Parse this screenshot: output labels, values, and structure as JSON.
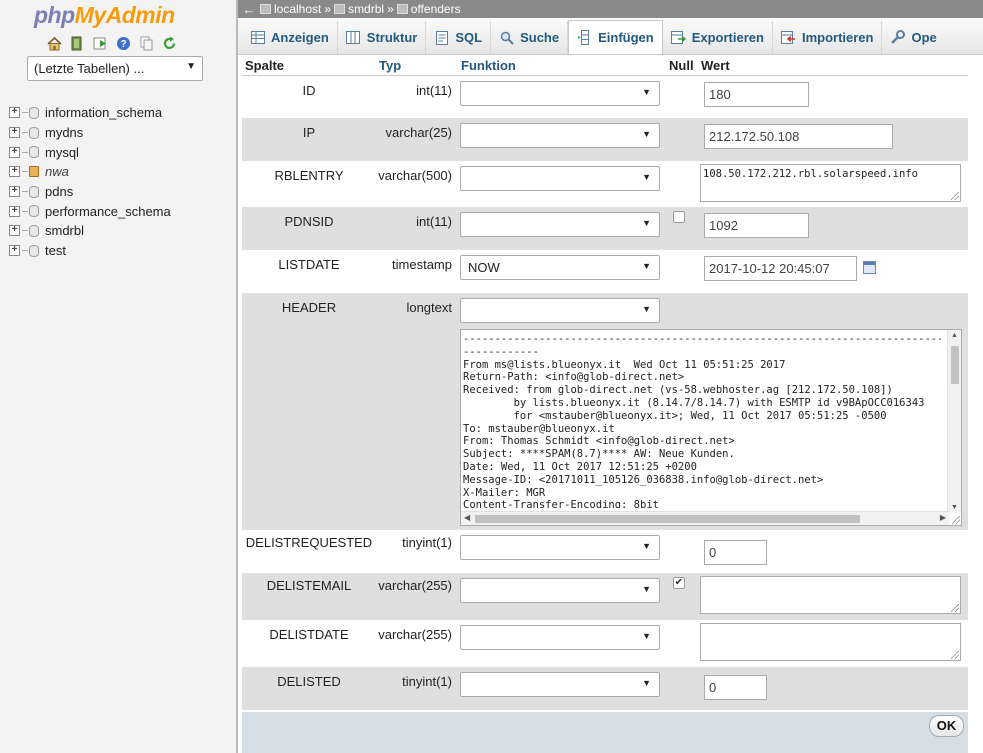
{
  "nav": {
    "logo_php": "php",
    "logo_myadmin": "MyAdmin",
    "icons": [
      "home-icon",
      "logout-icon",
      "query-window-icon",
      "docs-icon",
      "copy-icon",
      "reload-icon"
    ],
    "recent_tables": "(Letzte Tabellen) ...",
    "databases": [
      {
        "name": "information_schema",
        "italic": false
      },
      {
        "name": "mydns",
        "italic": false
      },
      {
        "name": "mysql",
        "italic": false
      },
      {
        "name": "nwa",
        "italic": true
      },
      {
        "name": "pdns",
        "italic": false
      },
      {
        "name": "performance_schema",
        "italic": false
      },
      {
        "name": "smdrbl",
        "italic": false
      },
      {
        "name": "test",
        "italic": false
      }
    ]
  },
  "breadcrumb": {
    "back": "←",
    "server": "localhost",
    "database": "smdrbl",
    "table": "offenders",
    "separator": "»"
  },
  "tabs": [
    {
      "label": "Anzeigen",
      "icon": "browse-icon",
      "active": false
    },
    {
      "label": "Struktur",
      "icon": "structure-icon",
      "active": false
    },
    {
      "label": "SQL",
      "icon": "sql-icon",
      "active": false
    },
    {
      "label": "Suche",
      "icon": "search-icon",
      "active": false
    },
    {
      "label": "Einfügen",
      "icon": "insert-icon",
      "active": true
    },
    {
      "label": "Exportieren",
      "icon": "export-icon",
      "active": false
    },
    {
      "label": "Importieren",
      "icon": "import-icon",
      "active": false
    },
    {
      "label": "Ope",
      "icon": "operations-icon",
      "active": false
    }
  ],
  "table": {
    "headers": {
      "column": "Spalte",
      "type": "Typ",
      "function": "Funktion",
      "null": "Null",
      "value": "Wert"
    },
    "rows": [
      {
        "name": "ID",
        "type": "int(11)",
        "function": "",
        "null": null,
        "value": "180",
        "kind": "input",
        "width": 105
      },
      {
        "name": "IP",
        "type": "varchar(25)",
        "function": "",
        "null": null,
        "value": "212.172.50.108",
        "kind": "input",
        "width": 189
      },
      {
        "name": "RBLENTRY",
        "type": "varchar(500)",
        "function": "",
        "null": null,
        "value": "108.50.172.212.rbl.solarspeed.info",
        "kind": "textarea"
      },
      {
        "name": "PDNSID",
        "type": "int(11)",
        "function": "",
        "null": false,
        "value": "1092",
        "kind": "input",
        "width": 105
      },
      {
        "name": "LISTDATE",
        "type": "timestamp",
        "function": "NOW",
        "null": null,
        "value": "2017-10-12 20:45:07",
        "kind": "date",
        "width": 153
      },
      {
        "name": "HEADER",
        "type": "longtext",
        "function": "",
        "null": null,
        "value": "",
        "kind": "bigtext"
      },
      {
        "name": "DELISTREQUESTED",
        "type": "tinyint(1)",
        "function": "",
        "null": null,
        "value": "0",
        "kind": "input",
        "width": 63
      },
      {
        "name": "DELISTEMAIL",
        "type": "varchar(255)",
        "function": "",
        "null": true,
        "value": "",
        "kind": "textarea"
      },
      {
        "name": "DELISTDATE",
        "type": "varchar(255)",
        "function": "",
        "null": null,
        "value": "",
        "kind": "textarea"
      },
      {
        "name": "DELISTED",
        "type": "tinyint(1)",
        "function": "",
        "null": null,
        "value": "0",
        "kind": "input",
        "width": 63
      }
    ],
    "header_text": "------------------------------------------------------------------------------\n------------\nFrom ms@lists.blueonyx.it  Wed Oct 11 05:51:25 2017\nReturn-Path: <info@glob-direct.net>\nReceived: from glob-direct.net (vs-58.webhoster.ag [212.172.50.108])\n        by lists.blueonyx.it (8.14.7/8.14.7) with ESMTP id v9BApOCC016343\n        for <mstauber@blueonyx.it>; Wed, 11 Oct 2017 05:51:25 -0500\nTo: mstauber@blueonyx.it\nFrom: Thomas Schmidt <info@glob-direct.net>\nSubject: ****SPAM(8.7)**** AW: Neue Kunden.\nDate: Wed, 11 Oct 2017 12:51:25 +0200\nMessage-ID: <20171011_105126_036838.info@glob-direct.net>\nX-Mailer: MGR\nContent-Transfer-Encoding: 8bit"
  },
  "footer": {
    "ok_label": "OK"
  }
}
